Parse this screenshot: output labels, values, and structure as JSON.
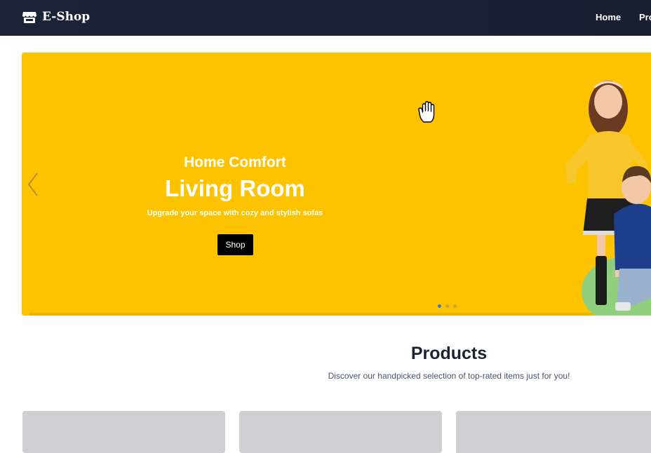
{
  "navbar": {
    "brand": "E-Shop",
    "brand_icon": "store-icon",
    "links": [
      {
        "label": "Home"
      },
      {
        "label": "Products"
      }
    ]
  },
  "hero": {
    "subtitle": "Home Comfort",
    "title": "Living Room",
    "tagline": "Upgrade your space with cozy and stylish sofas",
    "button_label": "Shop",
    "background_color": "#fdc300",
    "slide_count": 3,
    "active_slide": 1,
    "prev_icon": "chevron-left-icon"
  },
  "products": {
    "title": "Products",
    "subtitle": "Discover our handpicked selection of top-rated items just for you!",
    "card_count": 3
  },
  "colors": {
    "navbar_bg": "#1b2336",
    "accent_yellow": "#fdc300",
    "active_dot": "#3f76c5",
    "card_placeholder": "#cfced3"
  }
}
